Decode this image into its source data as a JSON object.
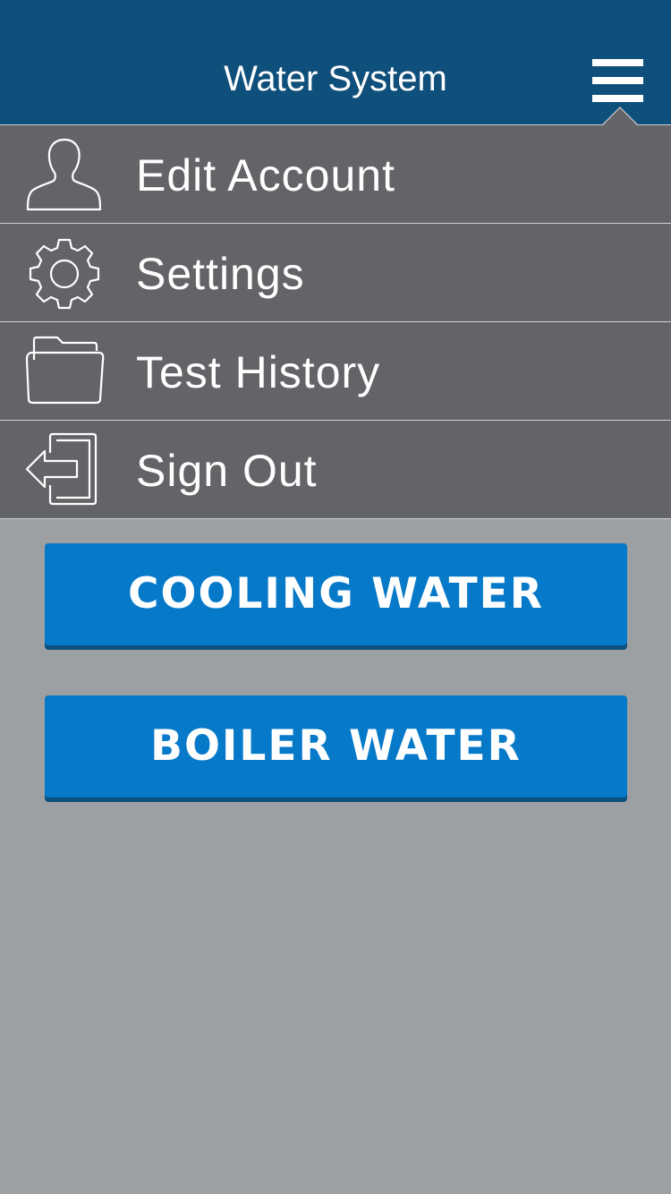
{
  "header": {
    "title": "Water System",
    "menu_icon": "hamburger-menu-icon"
  },
  "menu": {
    "items": [
      {
        "label": "Edit Account",
        "icon": "user-icon"
      },
      {
        "label": "Settings",
        "icon": "gear-icon"
      },
      {
        "label": "Test History",
        "icon": "folder-icon"
      },
      {
        "label": "Sign Out",
        "icon": "sign-out-icon"
      }
    ]
  },
  "buttons": {
    "cooling_water": "COOLING WATER",
    "boiler_water": "BOILER WATER"
  },
  "colors": {
    "header_bg": "#0f4f7b",
    "menu_bg": "#636467",
    "page_bg": "#9ca0a2",
    "button_bg": "#0679c8",
    "button_shadow": "#0d4f7d"
  }
}
